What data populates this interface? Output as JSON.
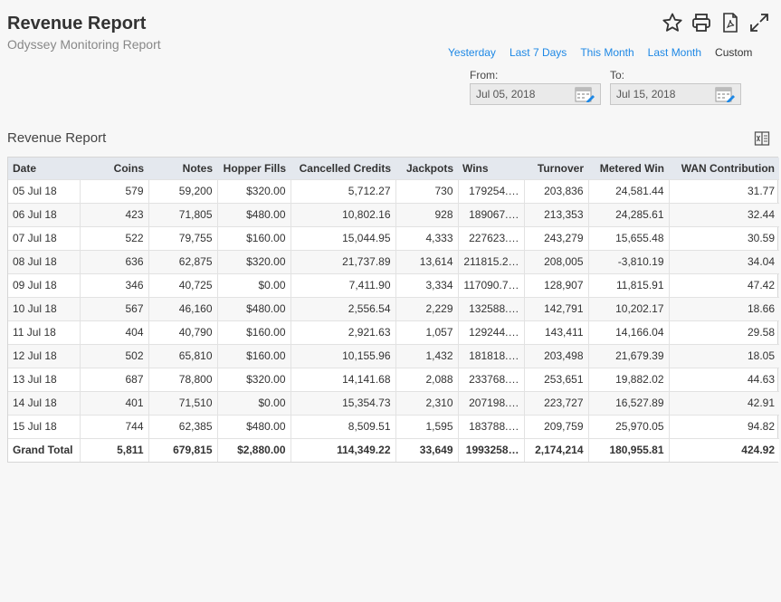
{
  "header": {
    "title": "Revenue Report",
    "subtitle": "Odyssey Monitoring Report"
  },
  "toolbar": {
    "icons": [
      "star-icon",
      "print-icon",
      "pdf-icon",
      "expand-icon"
    ]
  },
  "ranges": {
    "yesterday": "Yesterday",
    "last7": "Last 7 Days",
    "this_month": "This Month",
    "last_month": "Last Month",
    "custom": "Custom"
  },
  "dates": {
    "from_label": "From:",
    "from_value": "Jul 05, 2018",
    "to_label": "To:",
    "to_value": "Jul 15, 2018"
  },
  "report": {
    "title": "Revenue Report",
    "columns": [
      "Date",
      "Coins",
      "Notes",
      "Hopper Fills",
      "Cancelled Credits",
      "Jackpots",
      "Wins",
      "Turnover",
      "Metered Win",
      "WAN Contribution"
    ],
    "rows": [
      [
        "05 Jul 18",
        "579",
        "59,200",
        "$320.00",
        "5,712.27",
        "730",
        "179254.…",
        "203,836",
        "24,581.44",
        "31.77"
      ],
      [
        "06 Jul 18",
        "423",
        "71,805",
        "$480.00",
        "10,802.16",
        "928",
        "189067.…",
        "213,353",
        "24,285.61",
        "32.44"
      ],
      [
        "07 Jul 18",
        "522",
        "79,755",
        "$160.00",
        "15,044.95",
        "4,333",
        "227623.…",
        "243,279",
        "15,655.48",
        "30.59"
      ],
      [
        "08 Jul 18",
        "636",
        "62,875",
        "$320.00",
        "21,737.89",
        "13,614",
        "211815.2…",
        "208,005",
        "-3,810.19",
        "34.04"
      ],
      [
        "09 Jul 18",
        "346",
        "40,725",
        "$0.00",
        "7,411.90",
        "3,334",
        "117090.7…",
        "128,907",
        "11,815.91",
        "47.42"
      ],
      [
        "10 Jul 18",
        "567",
        "46,160",
        "$480.00",
        "2,556.54",
        "2,229",
        "132588.…",
        "142,791",
        "10,202.17",
        "18.66"
      ],
      [
        "11 Jul 18",
        "404",
        "40,790",
        "$160.00",
        "2,921.63",
        "1,057",
        "129244.…",
        "143,411",
        "14,166.04",
        "29.58"
      ],
      [
        "12 Jul 18",
        "502",
        "65,810",
        "$160.00",
        "10,155.96",
        "1,432",
        "181818.…",
        "203,498",
        "21,679.39",
        "18.05"
      ],
      [
        "13 Jul 18",
        "687",
        "78,800",
        "$320.00",
        "14,141.68",
        "2,088",
        "233768.…",
        "253,651",
        "19,882.02",
        "44.63"
      ],
      [
        "14 Jul 18",
        "401",
        "71,510",
        "$0.00",
        "15,354.73",
        "2,310",
        "207198.…",
        "223,727",
        "16,527.89",
        "42.91"
      ],
      [
        "15 Jul 18",
        "744",
        "62,385",
        "$480.00",
        "8,509.51",
        "1,595",
        "183788.…",
        "209,759",
        "25,970.05",
        "94.82"
      ]
    ],
    "total": [
      "Grand Total",
      "5,811",
      "679,815",
      "$2,880.00",
      "114,349.22",
      "33,649",
      "1993258…",
      "2,174,214",
      "180,955.81",
      "424.92"
    ]
  }
}
